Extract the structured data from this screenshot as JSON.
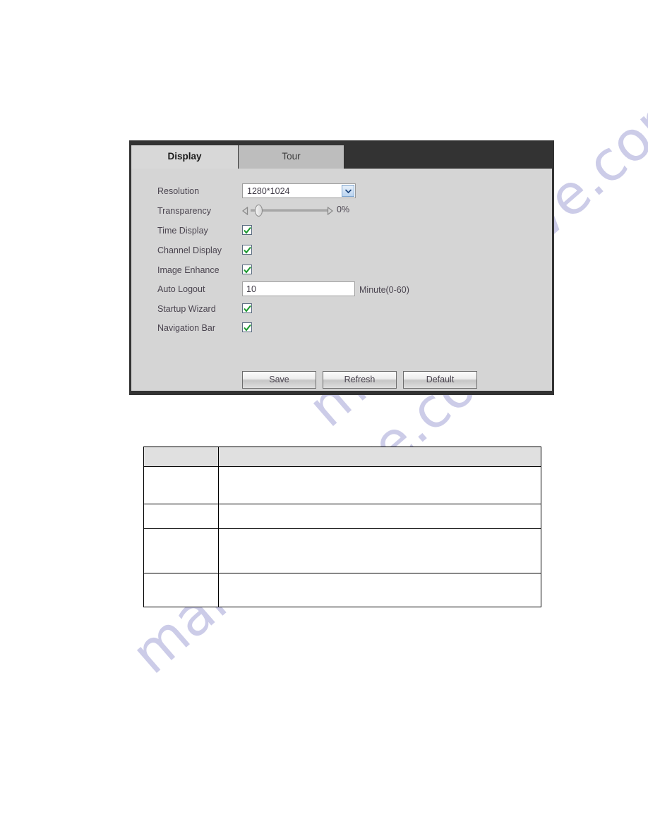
{
  "panel": {
    "tabs": [
      {
        "label": "Display",
        "active": true
      },
      {
        "label": "Tour",
        "active": false
      }
    ],
    "form": {
      "resolution": {
        "label": "Resolution",
        "value": "1280*1024",
        "icon": "chevron-down-icon"
      },
      "transparency": {
        "label": "Transparency",
        "value": "0%",
        "slider_position_percent": 0,
        "left_icon": "triangle-left-icon",
        "right_icon": "triangle-right-icon"
      },
      "time_display": {
        "label": "Time Display",
        "checked": true
      },
      "channel_display": {
        "label": "Channel Display",
        "checked": true
      },
      "image_enhance": {
        "label": "Image Enhance",
        "checked": true
      },
      "auto_logout": {
        "label": "Auto Logout",
        "value": "10",
        "unit": "Minute(0-60)"
      },
      "startup_wizard": {
        "label": "Startup Wizard",
        "checked": true
      },
      "navigation_bar": {
        "label": "Navigation Bar",
        "checked": true
      }
    },
    "buttons": {
      "save": "Save",
      "refresh": "Refresh",
      "default": "Default"
    }
  },
  "spec_table": {
    "header": [
      "",
      ""
    ],
    "rows": [
      [
        "",
        ""
      ],
      [
        "",
        ""
      ],
      [
        "",
        ""
      ],
      [
        "",
        ""
      ]
    ]
  },
  "watermark": {
    "text": "manualshive.com"
  },
  "colors": {
    "panel_frame": "#333333",
    "panel_body": "#d5d5d5",
    "tab_active": "#d8d8d8",
    "tab_inactive": "#bdbdbd",
    "checkbox_check": "#1d9a30",
    "select_arrow": "#2a5d9e",
    "watermark": "#b9b9e0",
    "table_header": "#e0e0e0"
  }
}
